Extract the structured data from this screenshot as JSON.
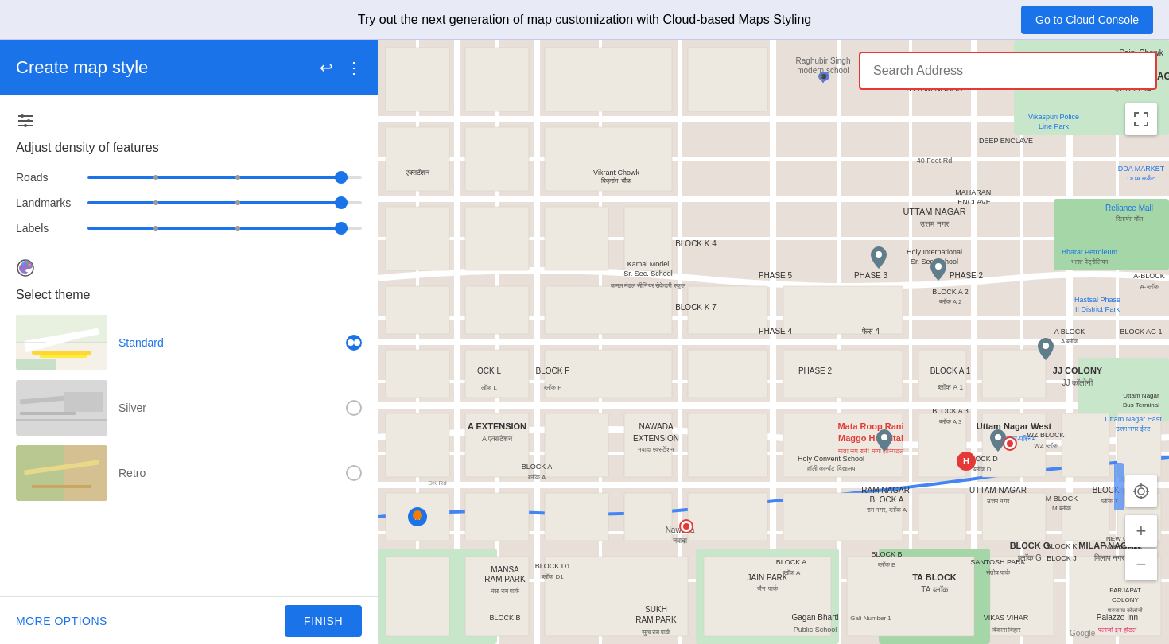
{
  "banner": {
    "text": "Try out the next generation of map customization with Cloud-based Maps Styling",
    "cloud_console_label": "Go to Cloud Console"
  },
  "sidebar": {
    "title": "Create map style",
    "undo_icon": "↩",
    "more_icon": "⋮",
    "density": {
      "icon": "⊞",
      "title": "Adjust density of features",
      "sliders": [
        {
          "label": "Roads",
          "value": 95,
          "dot1": 25,
          "dot2": 55
        },
        {
          "label": "Landmarks",
          "value": 95,
          "dot1": 25,
          "dot2": 55
        },
        {
          "label": "Labels",
          "value": 95,
          "dot1": 25,
          "dot2": 55
        }
      ]
    },
    "theme": {
      "icon": "🎨",
      "title": "Select theme",
      "themes": [
        {
          "id": "standard",
          "label": "Standard",
          "selected": true
        },
        {
          "id": "silver",
          "label": "Silver",
          "selected": false
        },
        {
          "id": "retro",
          "label": "Retro",
          "selected": false
        }
      ]
    },
    "more_options_label": "MORE OPTIONS",
    "finish_label": "FINISH"
  },
  "map": {
    "search_placeholder": "Search Address",
    "controls": {
      "expand": "⛶",
      "location": "◎",
      "zoom_in": "+",
      "zoom_out": "−"
    }
  }
}
